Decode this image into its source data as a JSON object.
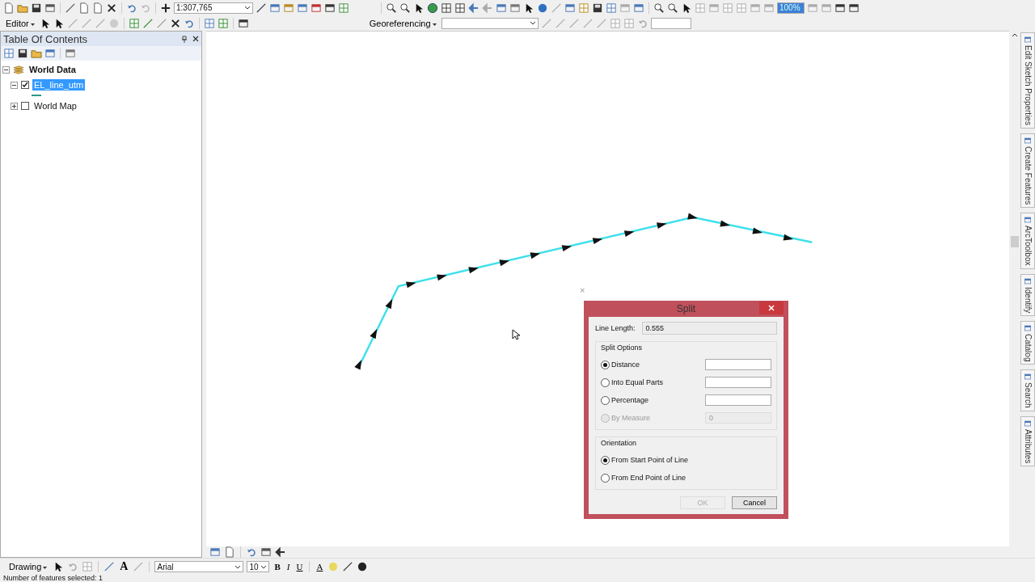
{
  "toolbar_standard": {
    "scale": "1:307,765",
    "zoom": "100%"
  },
  "toolbar_editor": {
    "editor_menu": "Editor",
    "georeferencing_menu": "Georeferencing"
  },
  "toc": {
    "title": "Table Of Contents",
    "items": [
      {
        "label": "World Data",
        "kind": "group",
        "expanded": true,
        "children": [
          {
            "label": "EL_line_utm",
            "kind": "layer",
            "checked": true,
            "expanded": true,
            "selected": true
          },
          {
            "label": "World Map",
            "kind": "layer",
            "checked": false,
            "expanded": false,
            "selected": false
          }
        ]
      }
    ]
  },
  "map": {
    "close_mark": "×"
  },
  "right_tabs": [
    "Edit Sketch Properties",
    "Create Features",
    "ArcToolbox",
    "Identify",
    "Catalog",
    "Search",
    "Attributes"
  ],
  "dialog": {
    "title": "Split",
    "line_length_label": "Line Length:",
    "line_length_value": "0.555",
    "split_options": {
      "title": "Split Options",
      "options": [
        {
          "label": "Distance",
          "selected": true,
          "disabled": false
        },
        {
          "label": "Into Equal Parts",
          "selected": false,
          "disabled": false
        },
        {
          "label": "Percentage",
          "selected": false,
          "disabled": false
        },
        {
          "label": "By Measure",
          "selected": false,
          "disabled": true,
          "value": "0"
        }
      ]
    },
    "orientation": {
      "title": "Orientation",
      "options": [
        {
          "label": "From Start Point of Line",
          "selected": true
        },
        {
          "label": "From End Point of Line",
          "selected": false
        }
      ]
    },
    "buttons": [
      {
        "label": "OK",
        "disabled": true
      },
      {
        "label": "Cancel",
        "disabled": false
      }
    ]
  },
  "drawing_toolbar": {
    "menu": "Drawing",
    "text_tool": "A",
    "font": "Arial",
    "size": "10",
    "bold": "B",
    "italic": "I",
    "underline": "U",
    "font_color": "A"
  },
  "status_bar": {
    "text": "Number of features selected: 1"
  }
}
